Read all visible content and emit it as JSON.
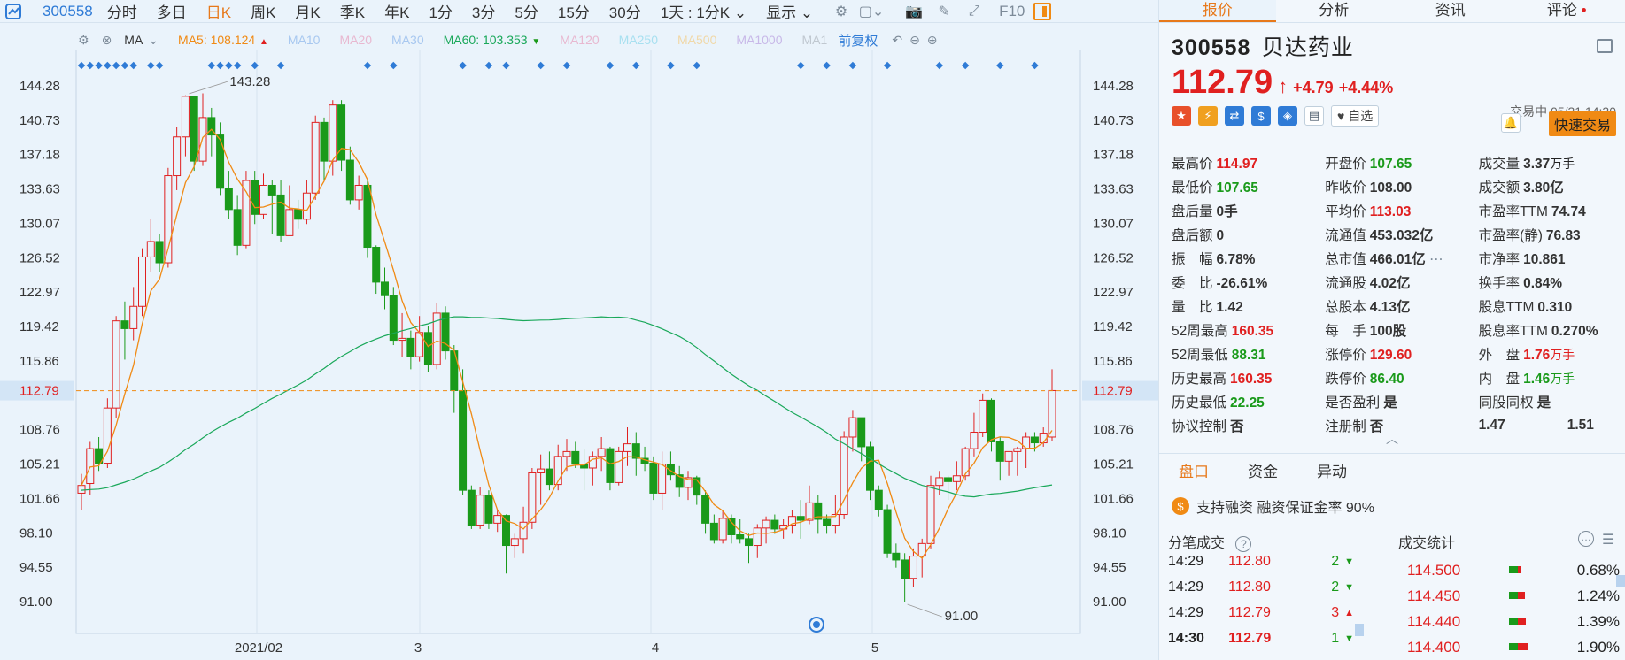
{
  "toolbar": {
    "code": "300558",
    "tabs": [
      "分时",
      "多日",
      "日K",
      "周K",
      "月K",
      "季K",
      "年K",
      "1分",
      "3分",
      "5分",
      "15分",
      "30分"
    ],
    "active_tab": "日K",
    "dropdown": "1天 : 1分K",
    "display_label": "显示",
    "f10_label": "F10"
  },
  "ma_bar": {
    "label": "MA",
    "items": [
      {
        "name": "MA5:",
        "value": "108.124",
        "color": "#f08a14",
        "arrow": "up"
      },
      {
        "name": "MA10",
        "value": "",
        "color": "#a8c8f0",
        "arrow": ""
      },
      {
        "name": "MA20",
        "value": "",
        "color": "#e8b8d0",
        "arrow": ""
      },
      {
        "name": "MA30",
        "value": "",
        "color": "#a8c8f0",
        "arrow": ""
      },
      {
        "name": "MA60:",
        "value": "103.353",
        "color": "#1aa85a",
        "arrow": "down"
      },
      {
        "name": "MA120",
        "value": "",
        "color": "#e8b8d0",
        "arrow": ""
      },
      {
        "name": "MA250",
        "value": "",
        "color": "#a8e0f0",
        "arrow": ""
      },
      {
        "name": "MA500",
        "value": "",
        "color": "#f0d8a8",
        "arrow": ""
      },
      {
        "name": "MA1000",
        "value": "",
        "color": "#c8b8e8",
        "arrow": ""
      },
      {
        "name": "MA1",
        "value": "",
        "color": "#c0c8d0",
        "arrow": ""
      }
    ],
    "adjust_label": "前复权"
  },
  "chart_data": {
    "type": "candlestick",
    "y_ticks": [
      "144.28",
      "140.73",
      "137.18",
      "133.63",
      "130.07",
      "126.52",
      "122.97",
      "119.42",
      "115.86",
      "112.79",
      "108.76",
      "105.21",
      "101.66",
      "98.10",
      "94.55",
      "91.00"
    ],
    "ylim": [
      91.0,
      144.28
    ],
    "x_labels": [
      "2021/02",
      "3",
      "4",
      "5"
    ],
    "current_price": "112.79",
    "high_annotation": "143.28",
    "low_annotation": "91.00",
    "candles": [
      [
        102.2,
        103.0,
        100.5,
        104.2
      ],
      [
        103.2,
        106.8,
        102.0,
        107.5
      ],
      [
        106.8,
        105.3,
        104.5,
        108.0
      ],
      [
        105.3,
        111.0,
        104.8,
        112.0
      ],
      [
        111.0,
        120.0,
        110.0,
        120.5
      ],
      [
        120.0,
        119.2,
        116.0,
        122.0
      ],
      [
        119.2,
        121.5,
        118.0,
        123.5
      ],
      [
        121.5,
        126.6,
        120.5,
        127.5
      ],
      [
        126.6,
        128.2,
        125.0,
        130.5
      ],
      [
        128.2,
        126.0,
        125.0,
        129.0
      ],
      [
        126.0,
        135.0,
        125.5,
        135.8
      ],
      [
        135.0,
        139.0,
        133.5,
        140.0
      ],
      [
        139.0,
        143.2,
        137.0,
        143.3
      ],
      [
        143.2,
        136.5,
        135.5,
        141.5
      ],
      [
        136.5,
        141.0,
        136.0,
        143.5
      ],
      [
        141.0,
        139.2,
        137.0,
        142.0
      ],
      [
        139.2,
        133.7,
        133.0,
        140.5
      ],
      [
        133.7,
        131.5,
        130.5,
        135.5
      ],
      [
        131.5,
        127.8,
        126.8,
        133.0
      ],
      [
        127.8,
        134.5,
        127.5,
        135.5
      ],
      [
        134.5,
        131.0,
        130.0,
        135.5
      ],
      [
        131.0,
        134.0,
        130.5,
        135.2
      ],
      [
        134.0,
        133.0,
        129.0,
        134.5
      ],
      [
        133.0,
        128.8,
        128.2,
        134.5
      ],
      [
        128.8,
        131.5,
        129.8,
        134.0
      ],
      [
        131.5,
        130.5,
        129.5,
        132.5
      ],
      [
        130.5,
        133.2,
        130.0,
        134.5
      ],
      [
        133.2,
        140.5,
        132.5,
        141.2
      ],
      [
        140.5,
        136.5,
        134.5,
        141.0
      ],
      [
        136.5,
        142.3,
        135.0,
        142.8
      ],
      [
        142.3,
        136.6,
        135.5,
        142.8
      ],
      [
        136.6,
        132.5,
        132.0,
        138.0
      ],
      [
        132.5,
        134.0,
        131.5,
        135.0
      ],
      [
        134.0,
        127.6,
        126.5,
        134.5
      ],
      [
        127.6,
        124.0,
        122.8,
        127.8
      ],
      [
        124.0,
        122.6,
        121.2,
        125.5
      ],
      [
        122.6,
        118.0,
        117.5,
        123.5
      ],
      [
        118.0,
        118.2,
        116.3,
        120.8
      ],
      [
        118.2,
        116.3,
        115.0,
        119.0
      ],
      [
        116.3,
        118.8,
        115.8,
        120.5
      ],
      [
        118.8,
        115.5,
        114.7,
        119.5
      ],
      [
        115.5,
        120.8,
        115.0,
        121.8
      ],
      [
        120.8,
        116.9,
        116.0,
        121.5
      ],
      [
        116.9,
        112.8,
        110.5,
        117.5
      ],
      [
        112.8,
        102.5,
        102.0,
        115.0
      ],
      [
        102.5,
        98.9,
        98.5,
        103.0
      ],
      [
        98.9,
        102.0,
        98.5,
        102.8
      ],
      [
        102.0,
        99.1,
        98.5,
        102.5
      ],
      [
        99.1,
        99.9,
        98.2,
        100.5
      ],
      [
        99.9,
        96.8,
        93.9,
        100.0
      ],
      [
        96.8,
        97.5,
        95.5,
        98.0
      ],
      [
        97.5,
        99.2,
        96.0,
        100.8
      ],
      [
        99.2,
        104.3,
        98.5,
        104.8
      ],
      [
        104.3,
        104.7,
        101.0,
        106.2
      ],
      [
        104.7,
        103.1,
        102.5,
        106.5
      ],
      [
        103.1,
        106.0,
        102.5,
        107.2
      ],
      [
        106.0,
        106.5,
        104.5,
        107.8
      ],
      [
        106.5,
        105.2,
        104.8,
        107.5
      ],
      [
        105.2,
        104.8,
        102.5,
        106.8
      ],
      [
        104.8,
        106.0,
        103.0,
        106.5
      ],
      [
        106.0,
        106.8,
        104.5,
        108.0
      ],
      [
        106.8,
        103.3,
        102.5,
        107.0
      ],
      [
        103.3,
        106.5,
        103.0,
        107.0
      ],
      [
        106.5,
        107.3,
        105.0,
        109.0
      ],
      [
        107.3,
        105.8,
        104.0,
        108.5
      ],
      [
        105.8,
        105.3,
        104.5,
        107.0
      ],
      [
        105.3,
        102.2,
        101.5,
        106.0
      ],
      [
        102.2,
        105.2,
        100.5,
        106.5
      ],
      [
        105.2,
        104.1,
        103.5,
        106.5
      ],
      [
        104.1,
        102.8,
        101.8,
        105.0
      ],
      [
        102.8,
        103.8,
        101.5,
        104.5
      ],
      [
        103.8,
        102.0,
        101.0,
        104.0
      ],
      [
        102.0,
        99.1,
        98.0,
        102.5
      ],
      [
        99.1,
        97.4,
        97.0,
        100.0
      ],
      [
        97.4,
        99.6,
        97.0,
        100.5
      ],
      [
        99.6,
        97.9,
        97.0,
        100.0
      ],
      [
        97.9,
        97.5,
        97.0,
        99.5
      ],
      [
        97.5,
        96.8,
        95.0,
        98.0
      ],
      [
        96.8,
        98.6,
        95.5,
        99.0
      ],
      [
        98.6,
        99.4,
        97.0,
        99.8
      ],
      [
        99.4,
        98.5,
        98.0,
        100.0
      ],
      [
        98.5,
        98.9,
        97.5,
        99.5
      ],
      [
        98.9,
        99.8,
        98.0,
        100.5
      ],
      [
        99.8,
        99.4,
        97.5,
        101.5
      ],
      [
        99.4,
        101.2,
        99.0,
        103.0
      ],
      [
        101.2,
        99.5,
        98.0,
        102.0
      ],
      [
        99.5,
        98.9,
        98.0,
        100.0
      ],
      [
        98.9,
        100.0,
        98.0,
        102.0
      ],
      [
        100.0,
        108.0,
        99.5,
        108.6
      ],
      [
        108.0,
        110.0,
        106.5,
        110.8
      ],
      [
        110.0,
        107.0,
        105.5,
        108.5
      ],
      [
        107.0,
        102.5,
        101.5,
        107.5
      ],
      [
        102.5,
        100.5,
        99.8,
        103.0
      ],
      [
        100.5,
        96.0,
        95.5,
        101.0
      ],
      [
        96.0,
        95.3,
        94.5,
        97.0
      ],
      [
        95.3,
        93.4,
        91.0,
        96.0
      ],
      [
        93.4,
        95.7,
        92.5,
        96.5
      ],
      [
        95.7,
        97.0,
        93.5,
        97.5
      ],
      [
        97.0,
        103.0,
        96.5,
        104.0
      ],
      [
        103.0,
        103.8,
        102.0,
        104.5
      ],
      [
        103.8,
        103.4,
        101.5,
        104.0
      ],
      [
        103.4,
        104.0,
        102.5,
        105.5
      ],
      [
        104.0,
        106.8,
        103.5,
        107.0
      ],
      [
        106.8,
        108.5,
        106.0,
        110.5
      ],
      [
        108.5,
        111.8,
        108.0,
        112.5
      ],
      [
        111.8,
        107.5,
        106.5,
        112.0
      ],
      [
        107.5,
        105.5,
        103.5,
        108.0
      ],
      [
        105.5,
        106.5,
        104.0,
        106.5
      ],
      [
        106.5,
        106.8,
        104.0,
        107.0
      ],
      [
        106.8,
        108.0,
        104.8,
        108.5
      ],
      [
        108.0,
        107.4,
        106.5,
        108.5
      ],
      [
        107.4,
        108.4,
        107.0,
        109.0
      ],
      [
        108.0,
        112.8,
        107.6,
        115.0
      ]
    ],
    "high_index": 12,
    "low_index": 95
  },
  "stock": {
    "code": "300558",
    "name": "贝达药业",
    "price": "112.79",
    "change": "+4.79",
    "change_pct": "+4.44%",
    "status": "交易中 05/31 14:30",
    "watch_label": "自选",
    "quick_trade_label": "快速交易"
  },
  "stats": [
    [
      {
        "k": "最高价",
        "v": "114.97",
        "c": "red"
      },
      {
        "k": "开盘价",
        "v": "107.65",
        "c": "green"
      },
      {
        "k": "成交量",
        "v": "3.37",
        "u": "万手",
        "c": ""
      }
    ],
    [
      {
        "k": "最低价",
        "v": "107.65",
        "c": "green"
      },
      {
        "k": "昨收价",
        "v": "108.00",
        "c": ""
      },
      {
        "k": "成交额",
        "v": "3.80亿",
        "c": ""
      }
    ],
    [
      {
        "k": "盘后量",
        "v": "0手",
        "c": ""
      },
      {
        "k": "平均价",
        "v": "113.03",
        "c": "red"
      },
      {
        "k": "市盈率TTM",
        "v": "74.74",
        "c": ""
      }
    ],
    [
      {
        "k": "盘后额",
        "v": "0",
        "c": ""
      },
      {
        "k": "流通值",
        "v": "453.032亿",
        "c": ""
      },
      {
        "k": "市盈率(静)",
        "v": "76.83",
        "c": ""
      }
    ],
    [
      {
        "k": "振　幅",
        "v": "6.78%",
        "c": ""
      },
      {
        "k": "总市值",
        "v": "466.01亿",
        "c": ""
      },
      {
        "k": "市净率",
        "v": "10.861",
        "c": ""
      }
    ],
    [
      {
        "k": "委　比",
        "v": "-26.61%",
        "c": ""
      },
      {
        "k": "流通股",
        "v": "4.02亿",
        "c": ""
      },
      {
        "k": "换手率",
        "v": "0.84%",
        "c": ""
      }
    ],
    [
      {
        "k": "量　比",
        "v": "1.42",
        "c": ""
      },
      {
        "k": "总股本",
        "v": "4.13亿",
        "c": ""
      },
      {
        "k": "股息TTM",
        "v": "0.310",
        "c": ""
      }
    ],
    [
      {
        "k": "52周最高",
        "v": "160.35",
        "c": "red"
      },
      {
        "k": "每　手",
        "v": "100股",
        "c": ""
      },
      {
        "k": "股息率TTM",
        "v": "0.270%",
        "c": ""
      }
    ],
    [
      {
        "k": "52周最低",
        "v": "88.31",
        "c": "green"
      },
      {
        "k": "涨停价",
        "v": "129.60",
        "c": "red"
      },
      {
        "k": "外　盘",
        "v": "1.76",
        "u": "万手",
        "c": "red"
      }
    ],
    [
      {
        "k": "历史最高",
        "v": "160.35",
        "c": "red"
      },
      {
        "k": "跌停价",
        "v": "86.40",
        "c": "green"
      },
      {
        "k": "内　盘",
        "v": "1.46",
        "u": "万手",
        "c": "green"
      }
    ],
    [
      {
        "k": "历史最低",
        "v": "22.25",
        "c": "green"
      },
      {
        "k": "是否盈利",
        "v": "是",
        "c": ""
      },
      {
        "k": "同股同权",
        "v": "是",
        "c": ""
      }
    ],
    [
      {
        "k": "协议控制",
        "v": "否",
        "c": ""
      },
      {
        "k": "注册制",
        "v": "否",
        "c": ""
      },
      {
        "k": "1.47",
        "v": "1.51",
        "c": ""
      }
    ]
  ],
  "panel_tabs": [
    "报价",
    "分析",
    "资讯",
    "评论"
  ],
  "sub_tabs": [
    "盘口",
    "资金",
    "异动"
  ],
  "margin_text": "支持融资 融资保证金率 90%",
  "trade_header": {
    "left": "分笔成交",
    "right": "成交统计"
  },
  "trades": [
    {
      "time": "14:29",
      "price": "112.80",
      "vol": "2",
      "dir": "down"
    },
    {
      "time": "14:29",
      "price": "112.80",
      "vol": "2",
      "dir": "down"
    },
    {
      "time": "14:29",
      "price": "112.79",
      "vol": "3",
      "dir": "up"
    },
    {
      "time": "14:30",
      "price": "112.79",
      "vol": "1",
      "dir": "down"
    }
  ],
  "dist": [
    {
      "price": "114.500",
      "pct": "0.68%",
      "fill": 0.3
    },
    {
      "price": "114.450",
      "pct": "1.24%",
      "fill": 0.55
    },
    {
      "price": "114.440",
      "pct": "1.39%",
      "fill": 0.62
    },
    {
      "price": "114.400",
      "pct": "1.90%",
      "fill": 0.8
    }
  ]
}
